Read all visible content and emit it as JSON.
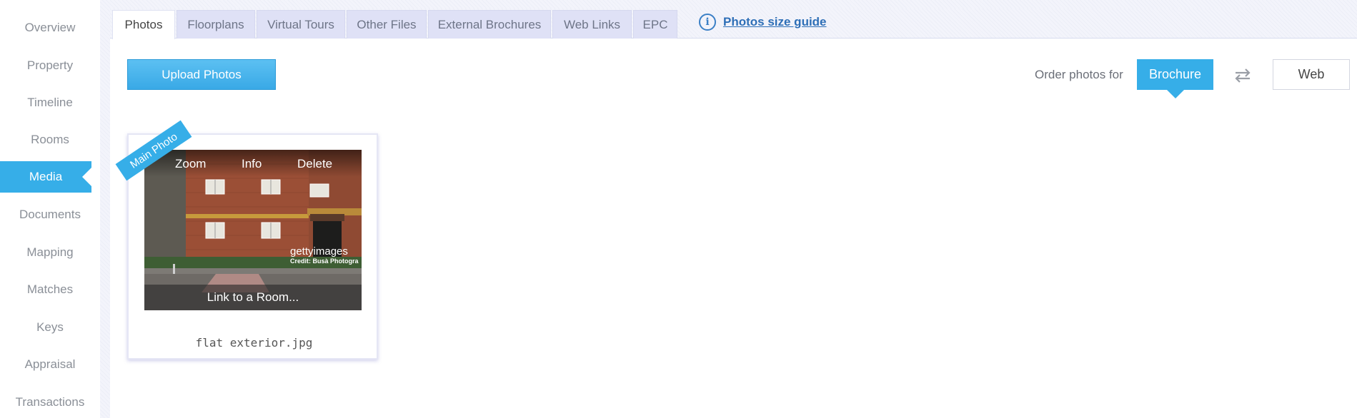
{
  "sidebar": {
    "items": [
      {
        "label": "Overview",
        "active": false
      },
      {
        "label": "Property",
        "active": false
      },
      {
        "label": "Timeline",
        "active": false
      },
      {
        "label": "Rooms",
        "active": false
      },
      {
        "label": "Media",
        "active": true
      },
      {
        "label": "Documents",
        "active": false
      },
      {
        "label": "Mapping",
        "active": false
      },
      {
        "label": "Matches",
        "active": false
      },
      {
        "label": "Keys",
        "active": false
      },
      {
        "label": "Appraisal",
        "active": false
      },
      {
        "label": "Transactions",
        "active": false
      }
    ]
  },
  "tabs": [
    {
      "label": "Photos",
      "active": true
    },
    {
      "label": "Floorplans",
      "active": false
    },
    {
      "label": "Virtual Tours",
      "active": false
    },
    {
      "label": "Other Files",
      "active": false
    },
    {
      "label": "External Brochures",
      "active": false
    },
    {
      "label": "Web Links",
      "active": false
    },
    {
      "label": "EPC",
      "active": false
    }
  ],
  "guide": {
    "icon": "info-circle-icon",
    "label": "Photos size guide"
  },
  "toolbar": {
    "upload_label": "Upload Photos",
    "order_label": "Order photos for",
    "brochure_label": "Brochure",
    "swap_icon": "swap-arrows-icon",
    "web_label": "Web"
  },
  "photos": [
    {
      "ribbon": "Main Photo",
      "actions": {
        "zoom": "Zoom",
        "info": "Info",
        "delete": "Delete"
      },
      "link_label": "Link to a Room...",
      "watermark_brand": "gettyimages",
      "watermark_credit": "Credit: Busà Photogra",
      "filename": "flat exterior.jpg"
    }
  ],
  "colors": {
    "accent": "#36aee8",
    "link": "#2e6fb7",
    "tab_inactive": "#dfe1f6"
  }
}
